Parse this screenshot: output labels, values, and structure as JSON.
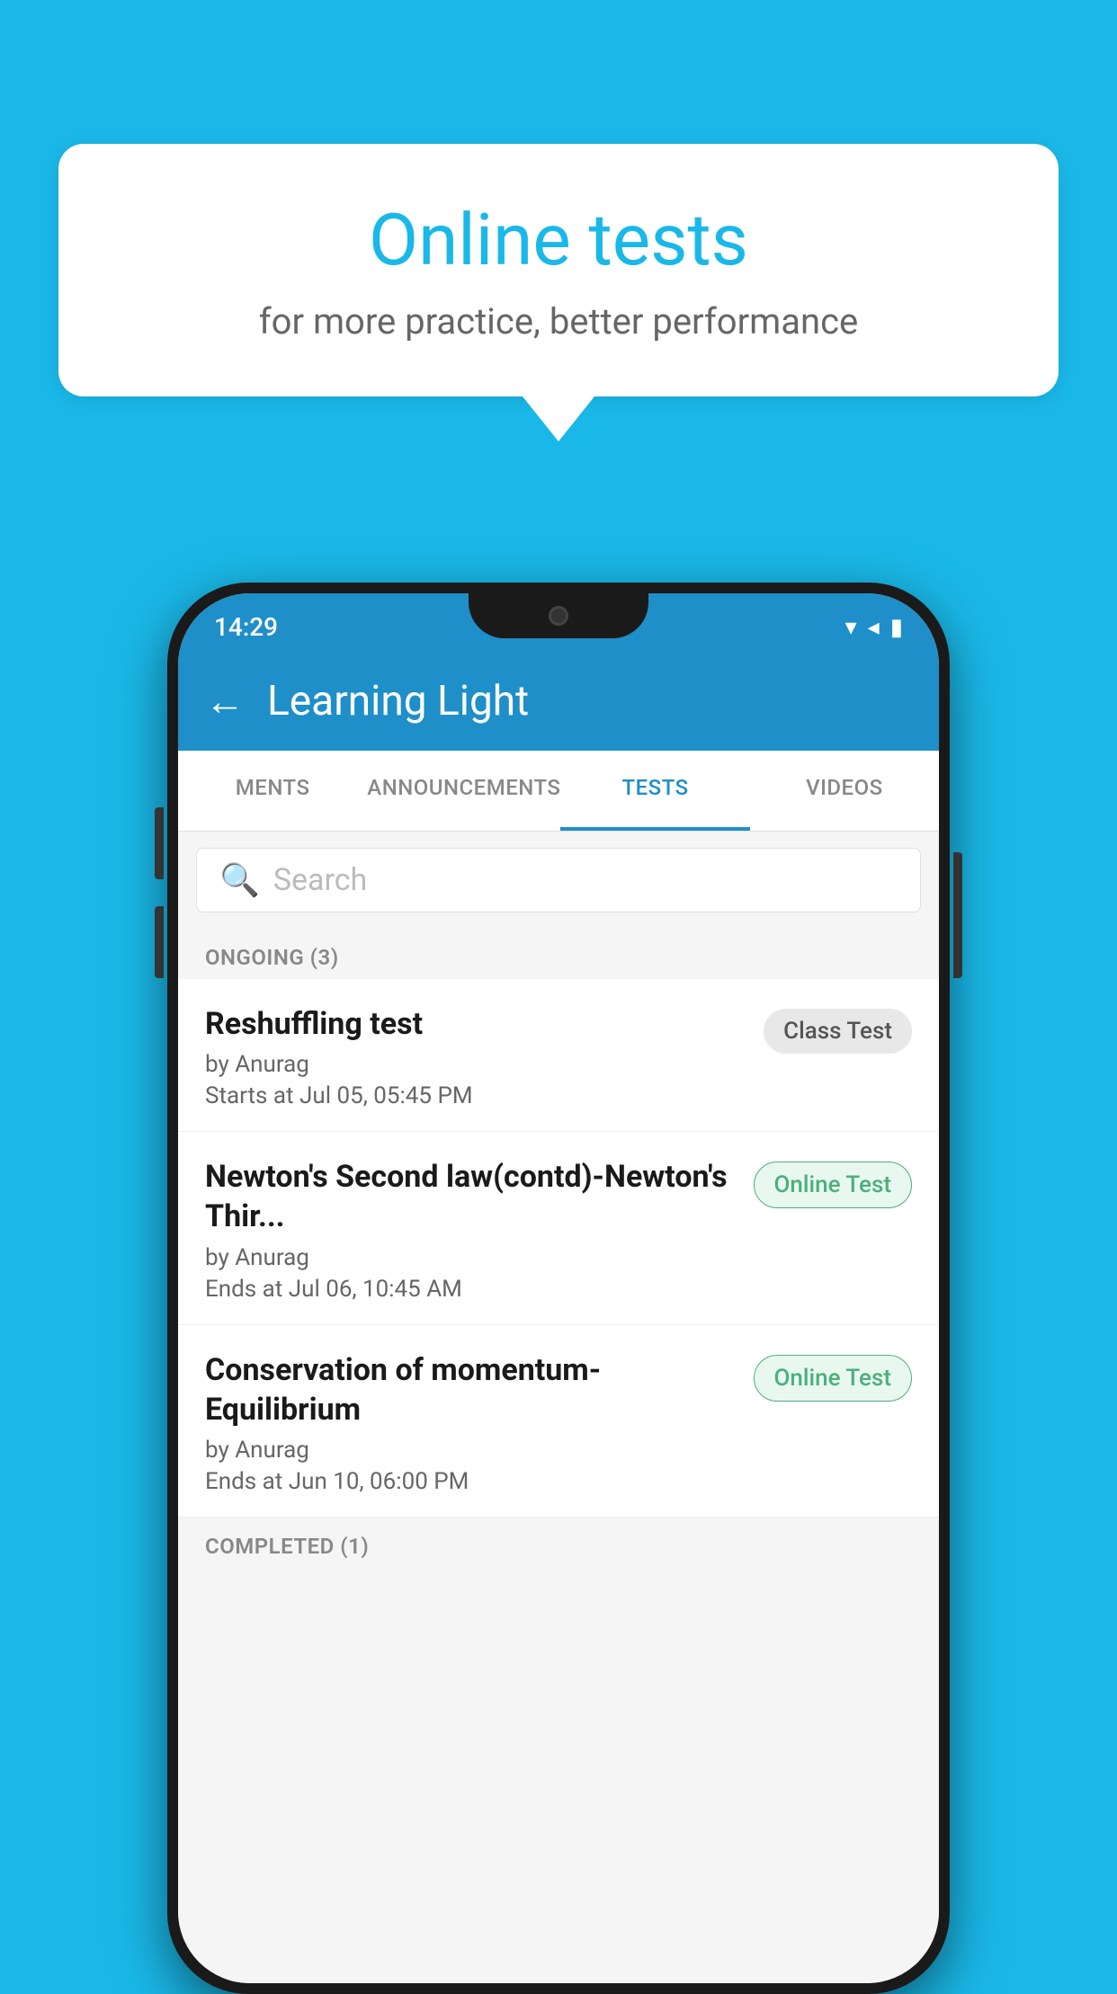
{
  "background": {
    "color": "#1ab8e8"
  },
  "speech_bubble": {
    "title": "Online tests",
    "subtitle": "for more practice, better performance"
  },
  "phone": {
    "status_bar": {
      "time": "14:29"
    },
    "app_bar": {
      "title": "Learning Light",
      "back_label": "←"
    },
    "tabs": [
      {
        "label": "MENTS",
        "active": false
      },
      {
        "label": "ANNOUNCEMENTS",
        "active": false
      },
      {
        "label": "TESTS",
        "active": true
      },
      {
        "label": "VIDEOS",
        "active": false
      }
    ],
    "search": {
      "placeholder": "Search"
    },
    "ongoing_section": {
      "header": "ONGOING (3)",
      "tests": [
        {
          "name": "Reshuffling test",
          "author": "by Anurag",
          "time_label": "Starts at",
          "time": "Jul 05, 05:45 PM",
          "badge": "Class Test",
          "badge_type": "class"
        },
        {
          "name": "Newton's Second law(contd)-Newton's Thir...",
          "author": "by Anurag",
          "time_label": "Ends at",
          "time": "Jul 06, 10:45 AM",
          "badge": "Online Test",
          "badge_type": "online"
        },
        {
          "name": "Conservation of momentum-Equilibrium",
          "author": "by Anurag",
          "time_label": "Ends at",
          "time": "Jun 10, 06:00 PM",
          "badge": "Online Test",
          "badge_type": "online"
        }
      ]
    },
    "completed_section": {
      "header": "COMPLETED (1)"
    }
  }
}
